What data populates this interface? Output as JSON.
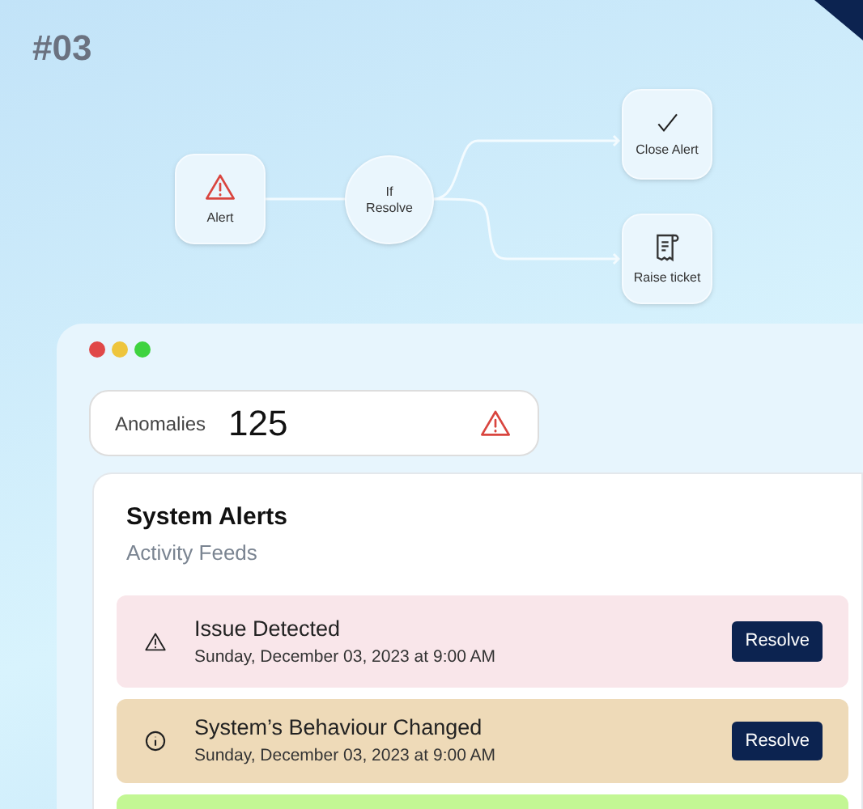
{
  "badge": "#03",
  "flow": {
    "nodes": [
      {
        "kind": "alert",
        "label": "Alert"
      },
      {
        "kind": "decision",
        "label": "If Resolve"
      },
      {
        "kind": "close",
        "label": "Close Alert"
      },
      {
        "kind": "ticket",
        "label": "Raise ticket"
      }
    ]
  },
  "window": {
    "dots": [
      {
        "color": "#e04848"
      },
      {
        "color": "#eec53c"
      },
      {
        "color": "#3fd33f"
      }
    ],
    "anomalies": {
      "label": "Anomalies",
      "count": "125"
    },
    "alerts": {
      "title": "System Alerts",
      "subtitle": "Activity Feeds",
      "items": [
        {
          "kind": "warning",
          "color": "#f9e6ea",
          "title": "Issue Detected",
          "time": "Sunday, December 03, 2023 at 9:00 AM",
          "button": "Resolve"
        },
        {
          "kind": "info",
          "color": "#eedab8",
          "title": "System’s Behaviour Changed",
          "time": "Sunday, December 03, 2023 at 9:00 AM",
          "button": "Resolve"
        },
        {
          "kind": "empty",
          "color": "#c3f794"
        }
      ]
    }
  }
}
